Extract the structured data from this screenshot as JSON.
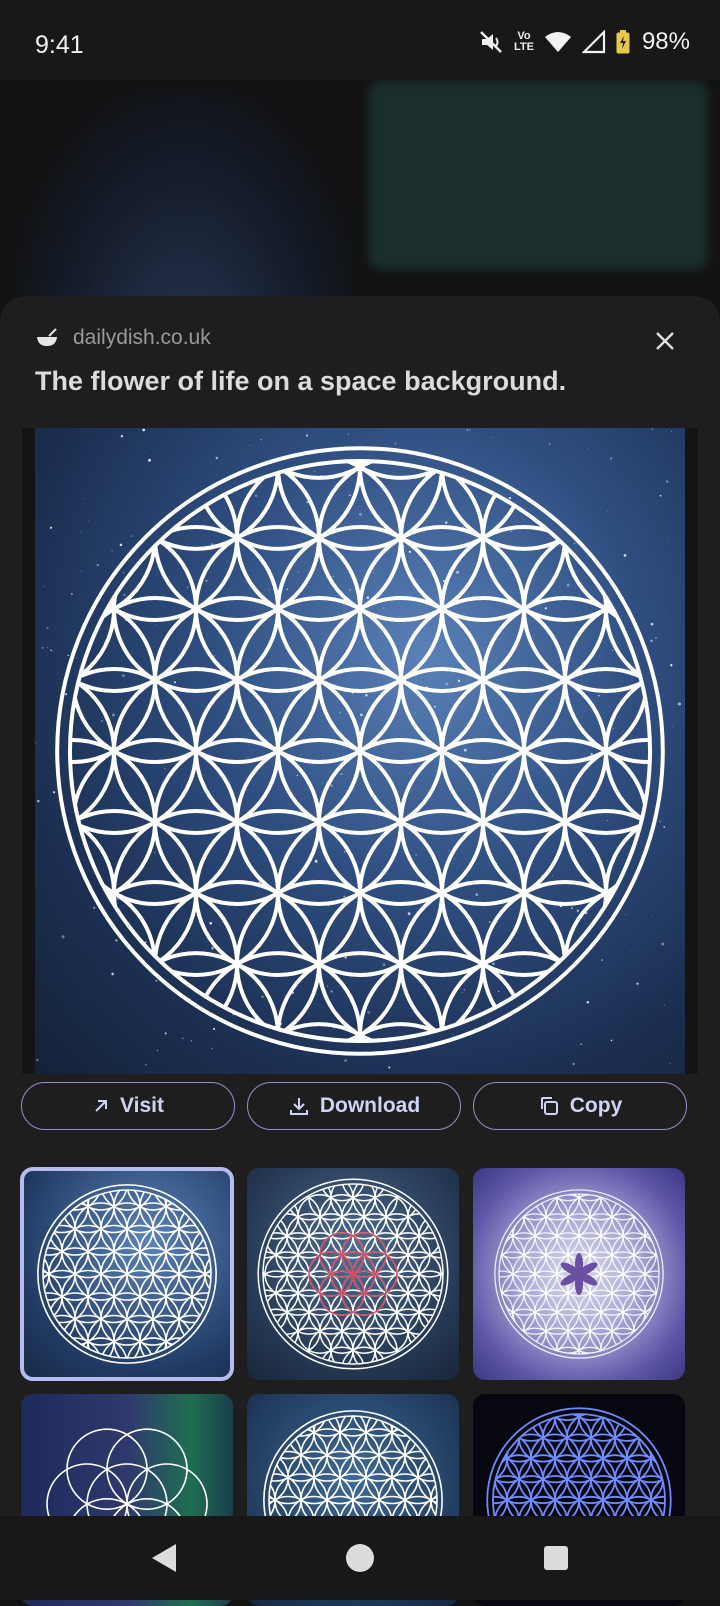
{
  "status_bar": {
    "time": "9:41",
    "volte_line1": "Vo",
    "volte_line2": "LTE",
    "battery": "98%"
  },
  "sheet": {
    "source": "dailydish.co.uk",
    "title": "The flower of life on a space background.",
    "actions": {
      "visit": "Visit",
      "download": "Download",
      "copy": "Copy"
    }
  },
  "colors": {
    "sheet_bg": "#1e1e1e",
    "accent_outline": "#8e95c9",
    "accent_text": "#cfd4f5",
    "selected_thumb": "#b6bcef"
  },
  "icons": {
    "source": "bowl-icon",
    "close": "close-icon",
    "visit": "arrow-up-right-icon",
    "download": "download-icon",
    "copy": "copy-icon",
    "nav_back": "back-triangle-icon",
    "nav_home": "home-circle-icon",
    "nav_recents": "recents-square-icon"
  },
  "thumbnails": [
    {
      "style": "blue-white",
      "selected": true
    },
    {
      "style": "blue-white-red-center",
      "selected": false
    },
    {
      "style": "purple-white",
      "selected": false
    },
    {
      "style": "aurora-seed",
      "selected": false
    },
    {
      "style": "blue-white",
      "selected": false
    },
    {
      "style": "black-blue",
      "selected": false
    }
  ]
}
